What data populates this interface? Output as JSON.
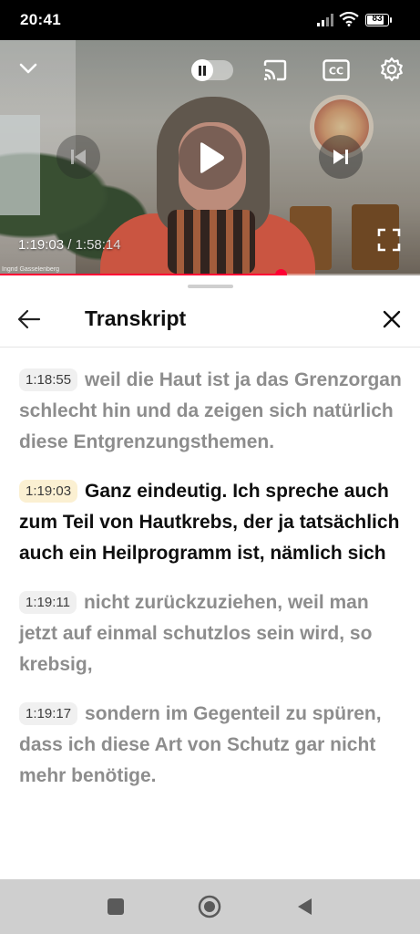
{
  "status_bar": {
    "time": "20:41",
    "battery_level": "83",
    "icons": [
      "signal-icon",
      "wifi-icon",
      "battery-icon"
    ]
  },
  "player": {
    "current_time": "1:19:03",
    "separator": " / ",
    "duration": "1:58:14",
    "progress": 0.668,
    "watermark": "Ingrid Gasselenberg",
    "icons": [
      "collapse-icon",
      "autoplay-toggle",
      "cast-icon",
      "captions-icon",
      "settings-icon",
      "previous-icon",
      "play-icon",
      "next-icon",
      "fullscreen-icon"
    ]
  },
  "transcript": {
    "title": "Transkript",
    "segments": [
      {
        "time": "1:18:55",
        "text": "weil die Haut ist ja das Grenzorgan schlecht hin und da zeigen sich natürlich diese Entgrenzungsthemen.",
        "active": false
      },
      {
        "time": "1:19:03",
        "text": "Ganz eindeutig. Ich spreche auch zum Teil von Hautkrebs, der ja tatsächlich auch ein Heilprogramm ist, nämlich sich",
        "active": true
      },
      {
        "time": "1:19:11",
        "text": "nicht zurückzuziehen, weil man jetzt auf einmal schutzlos sein wird, so krebsig,",
        "active": false
      },
      {
        "time": "1:19:17",
        "text": "sondern im Gegenteil zu spüren, dass ich diese Art von Schutz gar nicht mehr benötige.",
        "active": false
      }
    ]
  },
  "nav_bar": {
    "buttons": [
      "recents-icon",
      "home-icon",
      "back-icon"
    ]
  },
  "colors": {
    "accent": "#ff0033",
    "active_timestamp_bg": "#fbf0d2",
    "inactive_text": "#8d8d8d"
  }
}
